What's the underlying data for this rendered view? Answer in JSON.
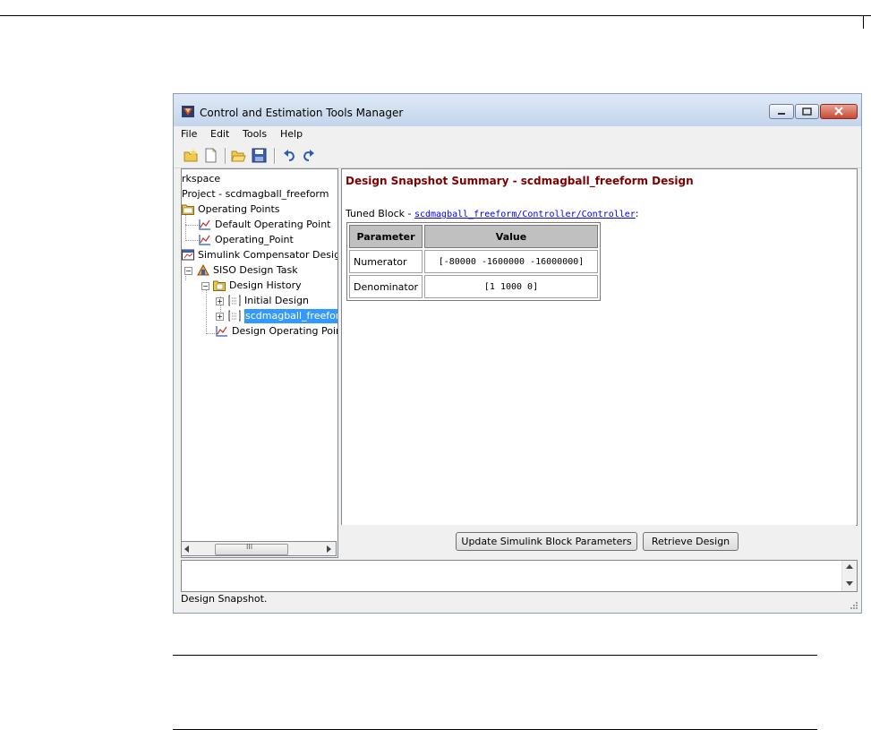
{
  "window": {
    "title": "Control and Estimation Tools Manager",
    "colors": {
      "title_gradient_top": "#dfe9f5",
      "title_gradient_bottom": "#c3d5ec",
      "close": "#c74a33"
    }
  },
  "menubar": {
    "items": [
      "File",
      "Edit",
      "Tools",
      "Help"
    ]
  },
  "toolbar": {
    "icons": [
      "new-project-icon",
      "new-task-icon",
      "open-icon",
      "save-icon",
      "undo-icon",
      "redo-icon"
    ]
  },
  "tree": {
    "items": [
      {
        "label": "rkspace"
      },
      {
        "label": "Project - scdmagball_freeform"
      },
      {
        "label": "Operating Points"
      },
      {
        "label": "Default Operating Point"
      },
      {
        "label": "Operating_Point"
      },
      {
        "label": "Simulink Compensator Design"
      },
      {
        "label": "SISO Design Task"
      },
      {
        "label": "Design History"
      },
      {
        "label": "Initial Design"
      },
      {
        "label": "scdmagball_freefor"
      },
      {
        "label": "Design Operating Point"
      }
    ],
    "scroll_glyph": "III"
  },
  "summary": {
    "title": "Design Snapshot Summary - scdmagball_freeform Design",
    "tuned_block_label": "Tuned Block - ",
    "tuned_block_link": "scdmagball_freeform/Controller/Controller",
    "tuned_block_suffix": ":",
    "table": {
      "headers": [
        "Parameter",
        "Value"
      ],
      "rows": [
        [
          "Numerator",
          "[-80000 -1600000 -16000000]"
        ],
        [
          "Denominator",
          "[1 1000 0]"
        ]
      ]
    },
    "title_color": "#800000"
  },
  "buttons": {
    "update": "Update Simulink Block Parameters",
    "retrieve": "Retrieve Design"
  },
  "status": {
    "text": "Design Snapshot."
  }
}
